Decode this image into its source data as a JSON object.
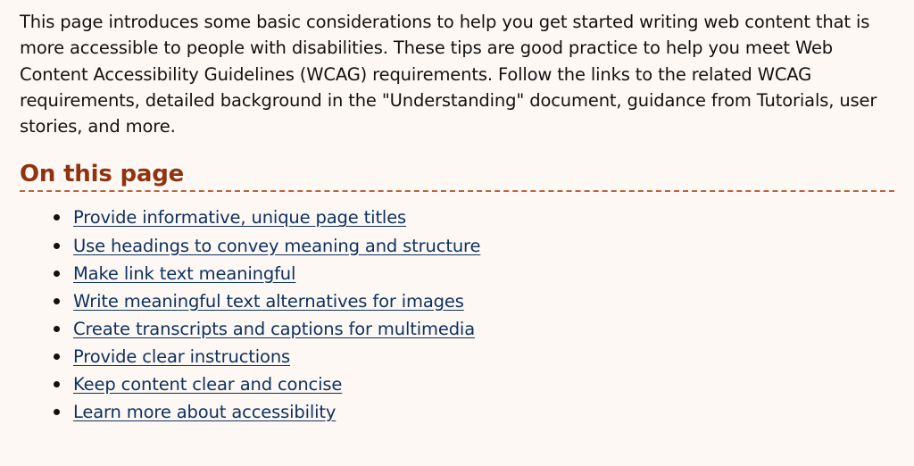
{
  "intro": {
    "text": "This page introduces some basic considerations to help you get started writing web content that is more accessible to people with disabilities. These tips are good practice to help you meet Web Content Accessibility Guidelines (WCAG) requirements. Follow the links to the related WCAG requirements, detailed background in the \"Understanding\" document, guidance from Tutorials, user stories, and more."
  },
  "toc": {
    "heading": "On this page",
    "items": [
      {
        "label": "Provide informative, unique page titles"
      },
      {
        "label": "Use headings to convey meaning and structure"
      },
      {
        "label": "Make link text meaningful"
      },
      {
        "label": "Write meaningful text alternatives for images"
      },
      {
        "label": "Create transcripts and captions for multimedia"
      },
      {
        "label": "Provide clear instructions"
      },
      {
        "label": "Keep content clear and concise"
      },
      {
        "label": "Learn more about accessibility"
      }
    ]
  },
  "colors": {
    "background": "#fef8f4",
    "heading": "#8f3410",
    "link": "#0d3260",
    "heading_border": "#b5663a"
  }
}
